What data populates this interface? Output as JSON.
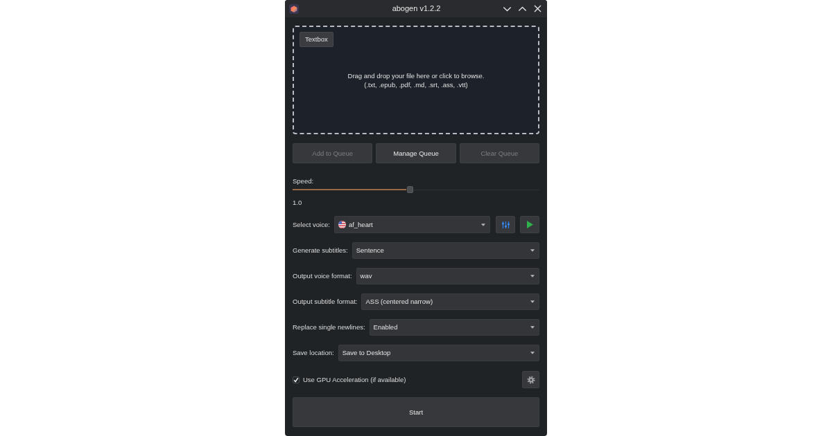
{
  "window": {
    "title": "abogen v1.2.2"
  },
  "drop_zone": {
    "tab_button": "Textbox",
    "hint": "Drag and drop your file here or click to browse.",
    "file_types": "(.txt, .epub, .pdf, .md, .srt, .ass, .vtt)"
  },
  "queue_buttons": [
    {
      "label": "Add to Queue",
      "disabled": true
    },
    {
      "label": "Manage Queue",
      "disabled": false
    },
    {
      "label": "Clear Queue",
      "disabled": true
    }
  ],
  "speed": {
    "label": "Speed:",
    "level": 0.476,
    "reading": "1.0"
  },
  "voice": {
    "label": "Select voice:",
    "value": "af_heart"
  },
  "options": [
    {
      "label": "Generate subtitles:",
      "value": "Sentence"
    },
    {
      "label": "Output voice format:",
      "value": "wav"
    },
    {
      "label": "Output subtitle format:",
      "value": "ASS (centered narrow)"
    },
    {
      "label": "Replace single newlines:",
      "value": "Enabled"
    },
    {
      "label": "Save location:",
      "value": "Save to Desktop"
    }
  ],
  "gpu": {
    "label": "Use GPU Acceleration (if available)",
    "checked": true
  },
  "start_button": {
    "label": "Start"
  }
}
